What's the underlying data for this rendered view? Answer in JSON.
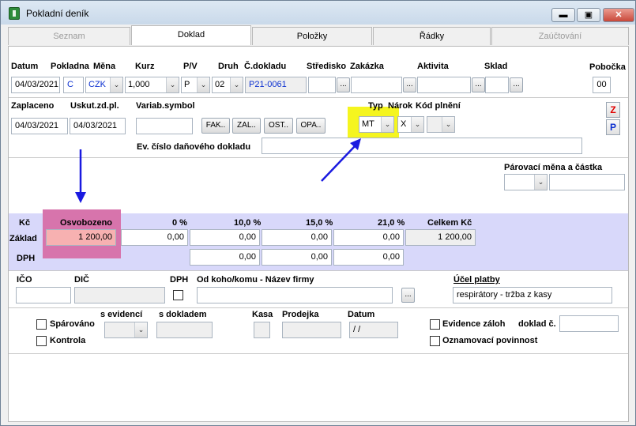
{
  "window": {
    "title": "Pokladní deník",
    "minimize_label": "▬",
    "maximize_label": "▣",
    "close_label": "✕"
  },
  "tabs": [
    {
      "label": "Seznam",
      "state": "disabled"
    },
    {
      "label": "Doklad",
      "state": "active"
    },
    {
      "label": "Položky",
      "state": "normal"
    },
    {
      "label": "Řádky",
      "state": "normal"
    },
    {
      "label": "Zaúčtování",
      "state": "disabled"
    }
  ],
  "header": {
    "labels": {
      "datum": "Datum",
      "pokladna": "Pokladna",
      "mena": "Měna",
      "kurz": "Kurz",
      "pv": "P/V",
      "druh": "Druh",
      "cdokladu": "Č.dokladu",
      "stredisko": "Středisko",
      "zakazka": "Zakázka",
      "aktivita": "Aktivita",
      "sklad": "Sklad",
      "pobocka": "Pobočka"
    },
    "values": {
      "datum": "04/03/2021",
      "pokladna": "C",
      "mena": "CZK",
      "kurz": "1,000",
      "pv": "P",
      "druh": "02",
      "cdokladu": "P21-0061",
      "stredisko": "",
      "zakazka": "",
      "aktivita": "",
      "sklad": "",
      "pobocka": "00"
    },
    "dots": "..."
  },
  "payment": {
    "labels": {
      "zaplaceno": "Zaplaceno",
      "uskut": "Uskut.zd.pl.",
      "varsymbol": "Variab.symbol",
      "typ": "Typ",
      "narok": "Nárok",
      "kodplneni": "Kód plnění",
      "evcislo": "Ev. číslo daňového dokladu",
      "parovaci": "Párovací měna a částka"
    },
    "values": {
      "zaplaceno": "04/03/2021",
      "uskut": "04/03/2021",
      "varsymbol": "",
      "typ": "MT",
      "narok": "X",
      "kodplneni": "",
      "evcislo": "",
      "parovaci_mena": "",
      "parovaci_castka": ""
    },
    "buttons": {
      "fak": "FAK..",
      "zal": "ZAL..",
      "ost": "OST..",
      "opa": "OPA.."
    },
    "side_buttons": {
      "z": "Z",
      "p": "P"
    }
  },
  "vat": {
    "currency_label": "Kč",
    "row_zaklad": "Základ",
    "row_dph": "DPH",
    "columns": [
      "Osvobozeno",
      "0 %",
      "10,0 %",
      "15,0 %",
      "21,0 %",
      "Celkem Kč"
    ],
    "zaklad": [
      "1 200,00",
      "0,00",
      "0,00",
      "0,00",
      "0,00",
      "1 200,00"
    ],
    "dph": [
      "0,00",
      "0,00",
      "0,00"
    ]
  },
  "partner": {
    "labels": {
      "ico": "IČO",
      "dic": "DIČ",
      "dph": "DPH",
      "nazev": "Od koho/komu - Název firmy",
      "ucel": "Účel platby"
    },
    "values": {
      "ico": "",
      "dic": "",
      "nazev": "",
      "ucel": "respirátory - tržba z kasy"
    }
  },
  "footer": {
    "labels": {
      "sparovano": "Spárováno",
      "kontrola": "Kontrola",
      "sevidenci": "s evidencí",
      "sdokladem": "s dokladem",
      "kasa": "Kasa",
      "prodejka": "Prodejka",
      "datum": "Datum",
      "evidencezaloh": "Evidence záloh",
      "dokladc": "doklad č.",
      "oznamovaci": "Oznamovací povinnost"
    },
    "values": {
      "datum": " / /",
      "dokladc": ""
    }
  },
  "colors": {
    "highlight_yellow": "#f5f51f",
    "highlight_pink": "#d774ac",
    "arrow": "#1a1ae0",
    "vat_band": "#d8d8fa"
  }
}
